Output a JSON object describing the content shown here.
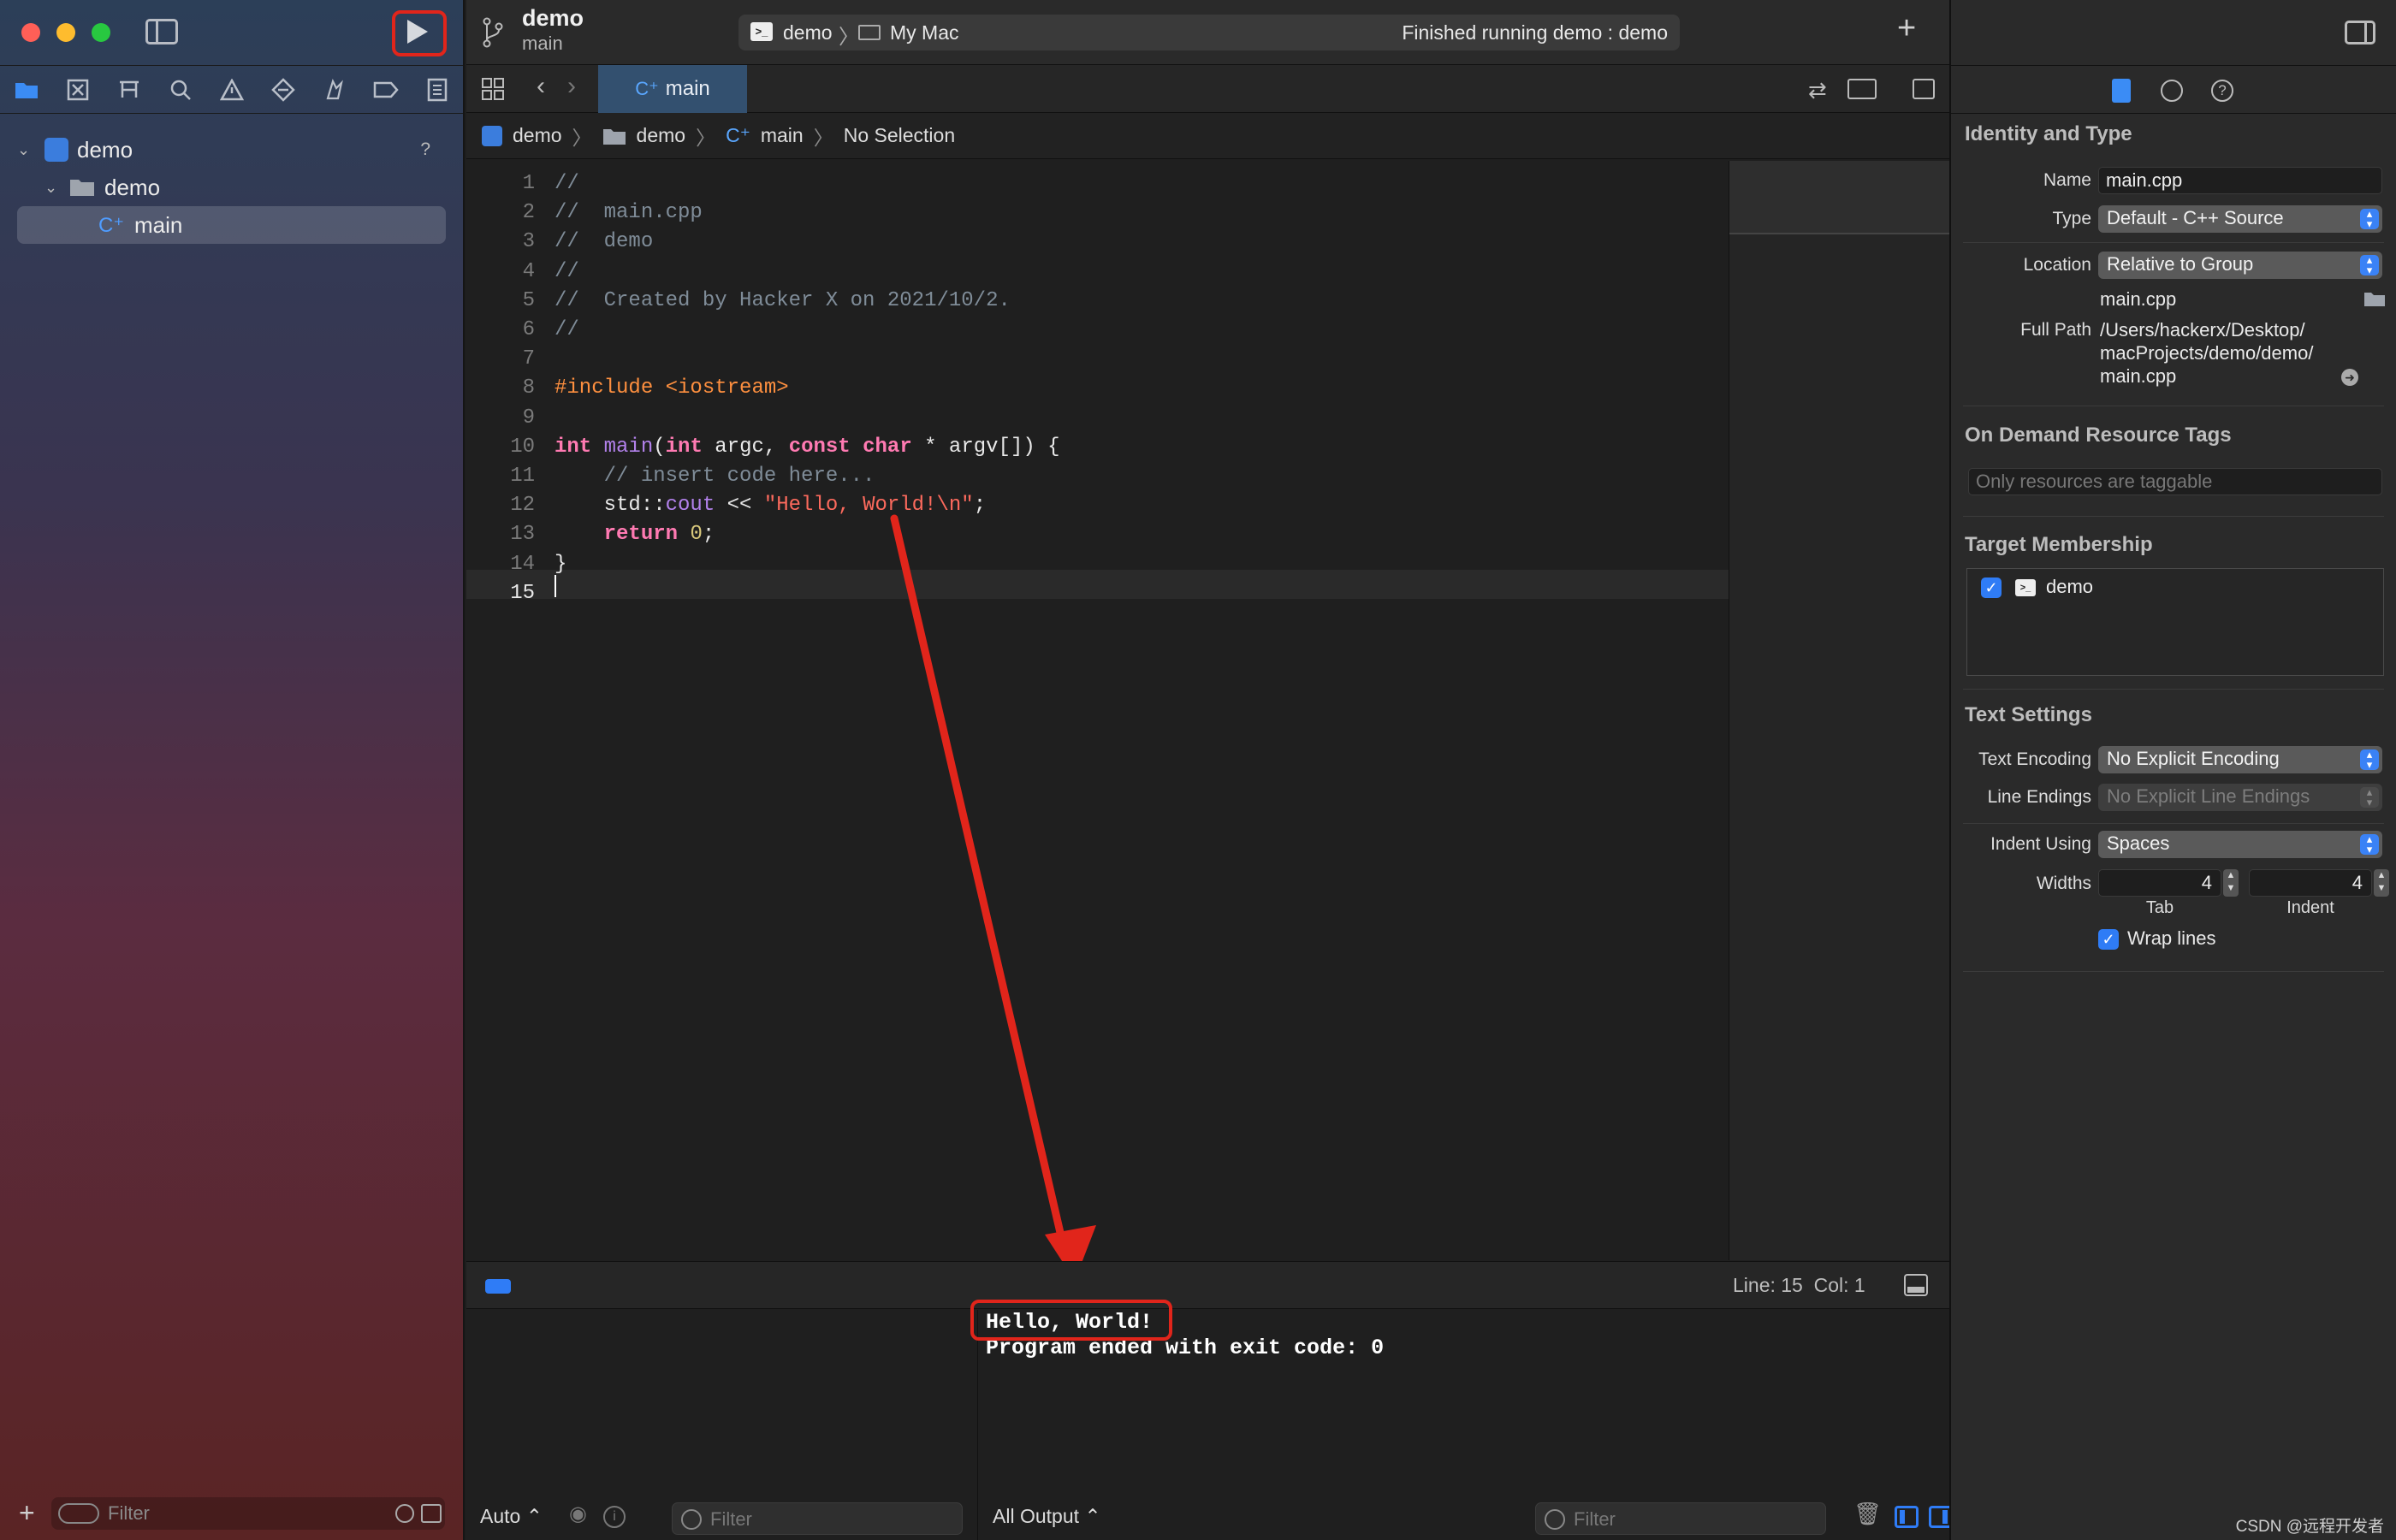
{
  "window": {
    "scheme_project": "demo",
    "scheme_branch": "main",
    "destination_target": "demo",
    "destination_device": "My Mac",
    "status": "Finished running demo : demo"
  },
  "navigator": {
    "tree": [
      {
        "label": "demo",
        "badge": "?"
      },
      {
        "label": "demo"
      },
      {
        "label": "main"
      }
    ],
    "filter_placeholder": "Filter"
  },
  "editor": {
    "tab_label": "main",
    "jump_bar": [
      "demo",
      "demo",
      "main",
      "No Selection"
    ],
    "current_line": 15,
    "code_lines": [
      "//",
      "//  main.cpp",
      "//  demo",
      "//",
      "//  Created by Hacker X on 2021/10/2.",
      "//",
      "",
      "#include <iostream>",
      "",
      "int main(int argc, const char * argv[]) {",
      "    // insert code here...",
      "    std::cout << \"Hello, World!\\n\";",
      "    return 0;",
      "}",
      ""
    ]
  },
  "debug": {
    "position": "Line: 15  Col: 1",
    "console_lines": [
      "Hello, World!",
      "Program ended with exit code: 0"
    ],
    "auto_label": "Auto",
    "output_label": "All Output",
    "filter_placeholder": "Filter"
  },
  "inspector": {
    "identity_title": "Identity and Type",
    "name_label": "Name",
    "name_value": "main.cpp",
    "type_label": "Type",
    "type_value": "Default - C++ Source",
    "location_label": "Location",
    "location_value": "Relative to Group",
    "location_file": "main.cpp",
    "fullpath_label": "Full Path",
    "fullpath_lines": [
      "/Users/hackerx/Desktop/",
      "macProjects/demo/demo/",
      "main.cpp"
    ],
    "odr_title": "On Demand Resource Tags",
    "odr_placeholder": "Only resources are taggable",
    "target_title": "Target Membership",
    "target_item": "demo",
    "text_title": "Text Settings",
    "encoding_label": "Text Encoding",
    "encoding_value": "No Explicit Encoding",
    "endings_label": "Line Endings",
    "endings_value": "No Explicit Line Endings",
    "indent_label": "Indent Using",
    "indent_value": "Spaces",
    "widths_label": "Widths",
    "tab_width": "4",
    "indent_width": "4",
    "tab_caption": "Tab",
    "indent_caption": "Indent",
    "wrap_label": "Wrap lines"
  },
  "watermark": "CSDN @远程开发者",
  "colors": {
    "annotation_red": "#e1251b",
    "accent": "#2f7cf6"
  }
}
